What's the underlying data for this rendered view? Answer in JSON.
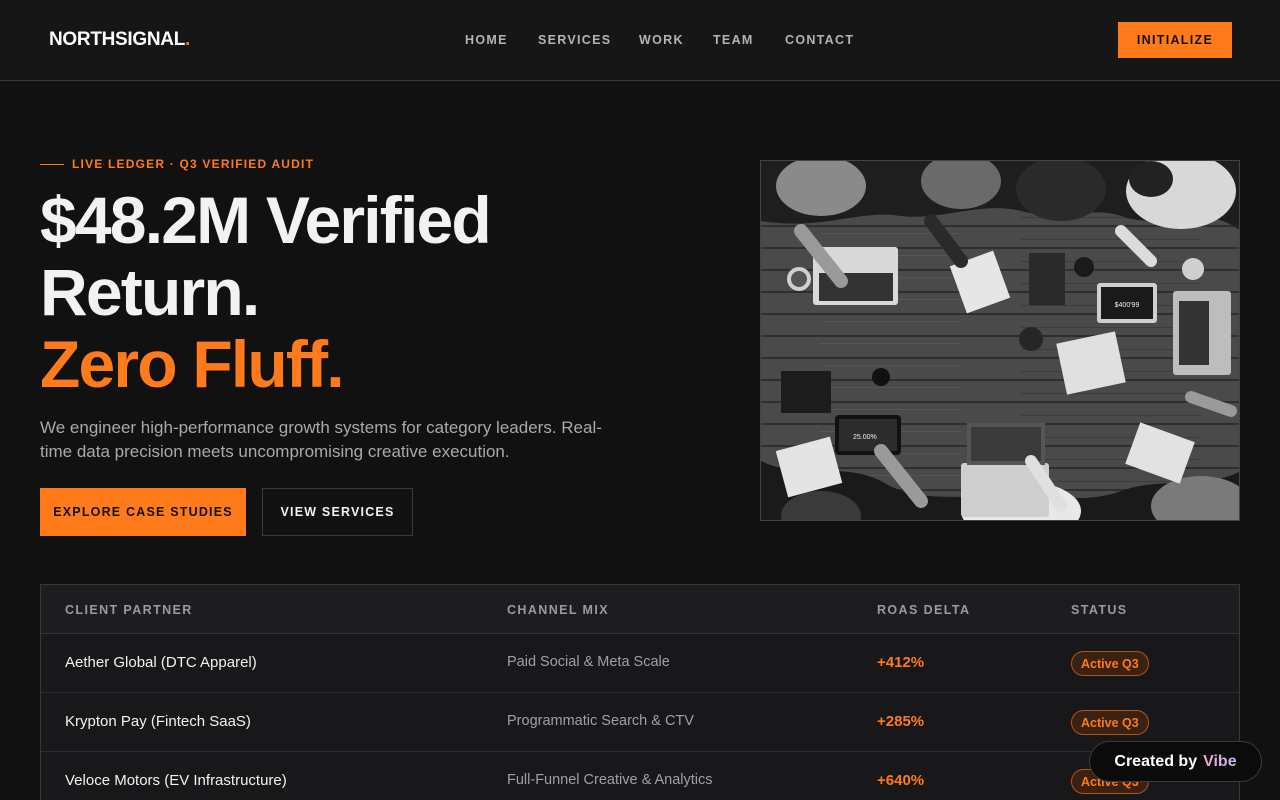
{
  "header": {
    "logo": "NORTHSIGNAL",
    "logo_dot": ".",
    "nav": [
      "HOME",
      "SERVICES",
      "WORK",
      "TEAM",
      "CONTACT"
    ],
    "cta": "INITIALIZE"
  },
  "hero": {
    "eyebrow": "LIVE LEDGER · Q3 VERIFIED AUDIT",
    "headline_line1": "$48.2M Verified",
    "headline_line2": "Return.",
    "headline_accent": "Zero Fluff.",
    "subtext": "We engineer high-performance growth systems for category leaders. Real-time data precision meets uncompromising creative execution.",
    "primary_button": "EXPLORE CASE STUDIES",
    "secondary_button": "VIEW SERVICES",
    "photo_screens": [
      "$400'99",
      "25.00%"
    ]
  },
  "table": {
    "headers": [
      "CLIENT PARTNER",
      "CHANNEL MIX",
      "ROAS DELTA",
      "STATUS"
    ],
    "rows": [
      {
        "client": "Aether Global (DTC Apparel)",
        "channel": "Paid Social & Meta Scale",
        "roas": "+412%",
        "status": "Active Q3"
      },
      {
        "client": "Krypton Pay (Fintech SaaS)",
        "channel": "Programmatic Search & CTV",
        "roas": "+285%",
        "status": "Active Q3"
      },
      {
        "client": "Veloce Motors (EV Infrastructure)",
        "channel": "Full-Funnel Creative & Analytics",
        "roas": "+640%",
        "status": "Active Q3"
      }
    ]
  },
  "floating_badge": {
    "label": "Created by",
    "brand": "Vibe"
  },
  "colors": {
    "accent": "#ff7a1a",
    "background": "#111112"
  }
}
